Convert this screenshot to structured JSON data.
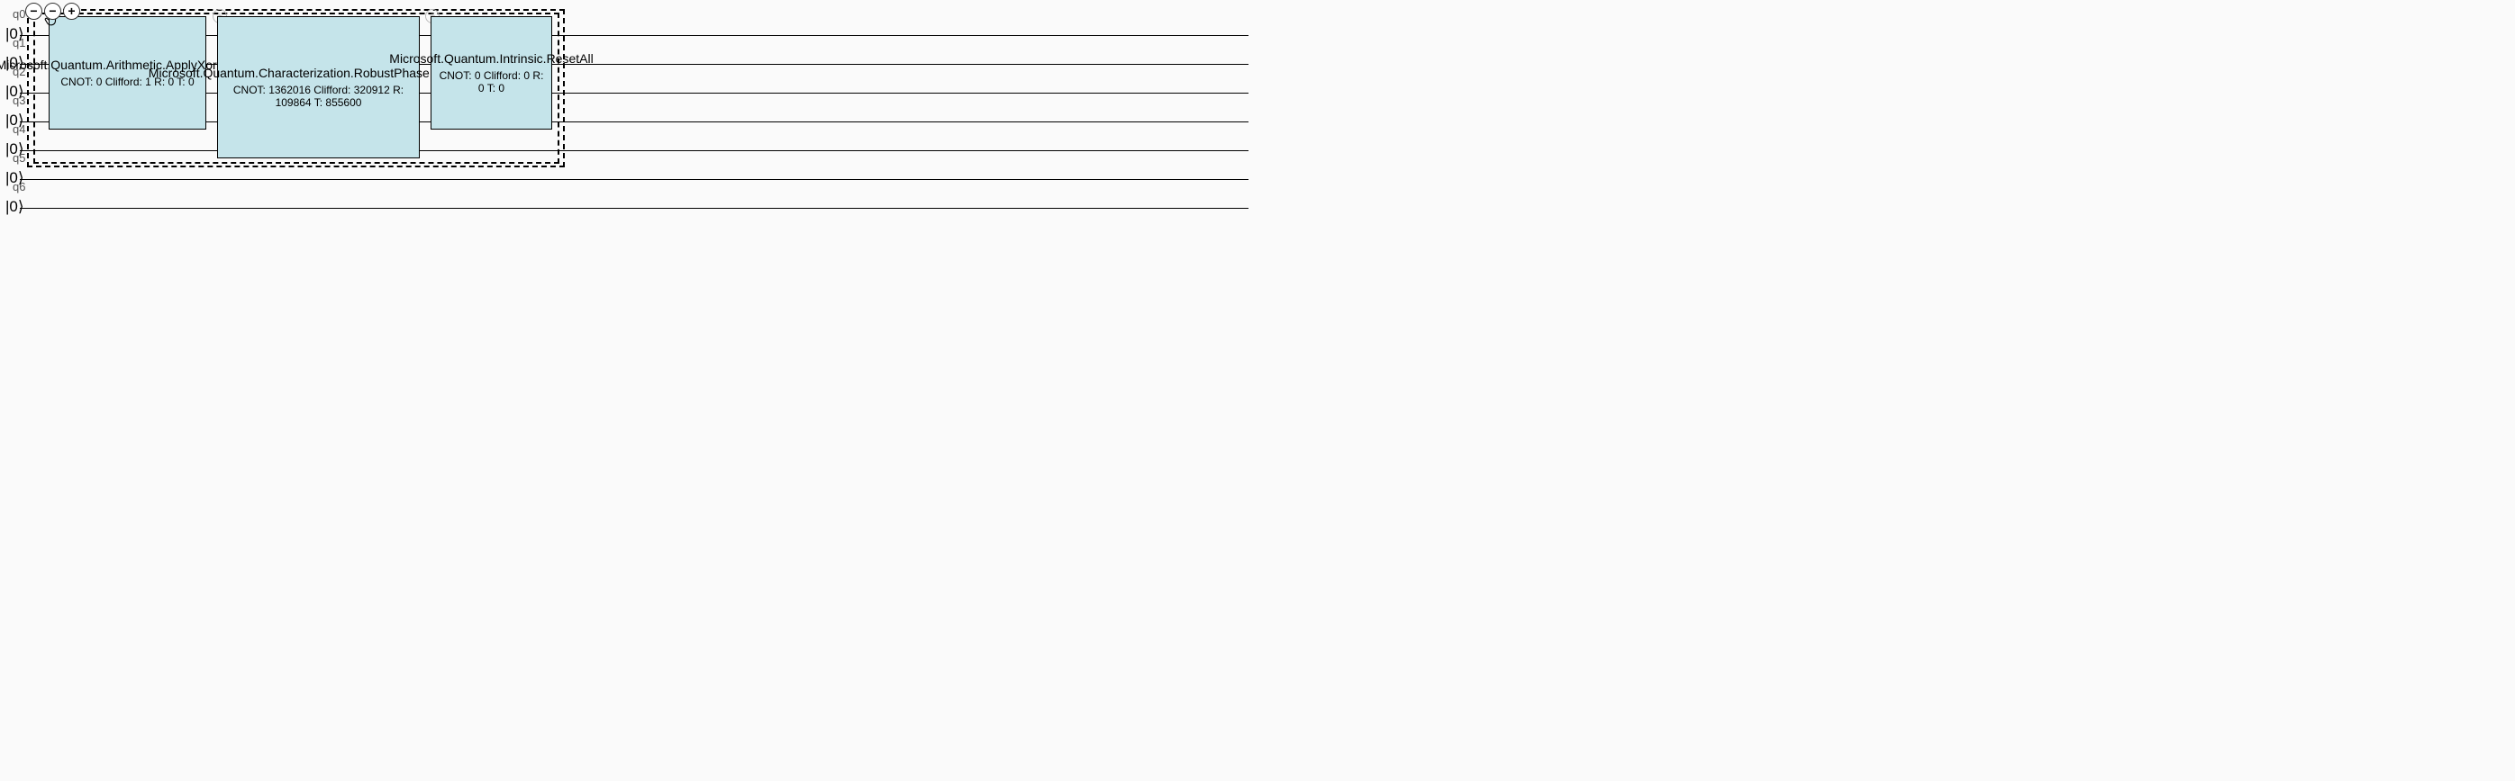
{
  "qubits": [
    {
      "name": "q0",
      "ket": "|0⟩"
    },
    {
      "name": "q1",
      "ket": "|0⟩"
    },
    {
      "name": "q2",
      "ket": "|0⟩"
    },
    {
      "name": "q3",
      "ket": "|0⟩"
    },
    {
      "name": "q4",
      "ket": "|0⟩"
    },
    {
      "name": "q5",
      "ket": "|0⟩"
    },
    {
      "name": "q6",
      "ket": "|0⟩"
    }
  ],
  "gates": [
    {
      "name": "Microsoft.Quantum.Arithmetic.ApplyXorInPlace",
      "stats": "CNOT: 0 Clifford: 1 R: 0 T: 0"
    },
    {
      "name": "Microsoft.Quantum.Characterization.RobustPhaseEstimation",
      "stats": "CNOT: 1362016 Clifford: 320912 R: 109864 T: 855600"
    },
    {
      "name": "Microsoft.Quantum.Intrinsic.ResetAll",
      "stats": "CNOT: 0 Clifford: 0 R: 0 T: 0"
    }
  ],
  "zoom": {
    "out1": "−",
    "out2": "−",
    "in": "+"
  }
}
